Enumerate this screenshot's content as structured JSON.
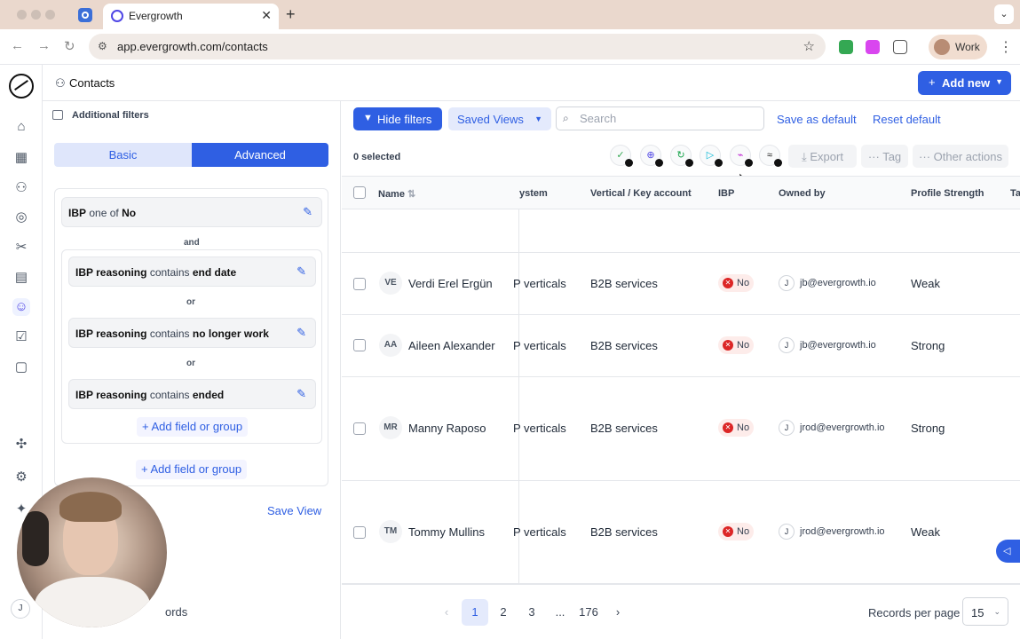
{
  "browser": {
    "tab_title": "Evergrowth",
    "url": "app.evergrowth.com/contacts",
    "profile_label": "Work"
  },
  "topbar": {
    "title": "Contacts",
    "add_new_label": "Add new"
  },
  "filters": {
    "header": "Additional filters",
    "tab_basic": "Basic",
    "tab_advanced": "Advanced",
    "conditions": [
      {
        "field": "IBP",
        "op": "one of",
        "value": "No"
      },
      {
        "field": "IBP reasoning",
        "op": "contains",
        "value": "end date"
      },
      {
        "field": "IBP reasoning",
        "op": "contains",
        "value": "no longer work"
      },
      {
        "field": "IBP reasoning",
        "op": "contains",
        "value": "ended"
      }
    ],
    "connector_and": "and",
    "connector_or": "or",
    "add_field_label": "Add field or group",
    "save_view_label": "Save View",
    "records_partial": "ords"
  },
  "actions": {
    "hide_filters_label": "Hide filters",
    "saved_views_label": "Saved Views",
    "search_placeholder": "Search",
    "save_default_label": "Save as default",
    "reset_default_label": "Reset default",
    "selected_text": "0 selected",
    "export_label": "Export",
    "tag_label": "Tag",
    "other_actions_label": "Other actions"
  },
  "table": {
    "columns": [
      "Name",
      "ystem",
      "Vertical / Key account",
      "IBP",
      "Owned by",
      "Profile Strength",
      "Ta"
    ],
    "rows": [
      {
        "initials": "VE",
        "name": "Verdi Erel Ergün",
        "system": "P verticals",
        "vertical": "B2B services",
        "ibp": "No",
        "owner_initial": "J",
        "owner": "jb@evergrowth.io",
        "strength": "Weak"
      },
      {
        "initials": "AA",
        "name": "Aileen Alexander",
        "system": "P verticals",
        "vertical": "B2B services",
        "ibp": "No",
        "owner_initial": "J",
        "owner": "jb@evergrowth.io",
        "strength": "Strong"
      },
      {
        "initials": "MR",
        "name": "Manny Raposo",
        "system": "P verticals",
        "vertical": "B2B services",
        "ibp": "No",
        "owner_initial": "J",
        "owner": "jrod@evergrowth.io",
        "strength": "Strong"
      },
      {
        "initials": "TM",
        "name": "Tommy Mullins",
        "system": "P verticals",
        "vertical": "B2B services",
        "ibp": "No",
        "owner_initial": "J",
        "owner": "jrod@evergrowth.io",
        "strength": "Weak"
      }
    ]
  },
  "pagination": {
    "pages": [
      "1",
      "2",
      "3",
      "...",
      "176"
    ],
    "current": "1",
    "records_per_page_label": "Records per page",
    "records_per_page_value": "15"
  },
  "user": {
    "initial": "J"
  },
  "colors": {
    "accent": "#2f5fe3",
    "danger": "#dc2626",
    "chrome": "#ead8cd"
  }
}
